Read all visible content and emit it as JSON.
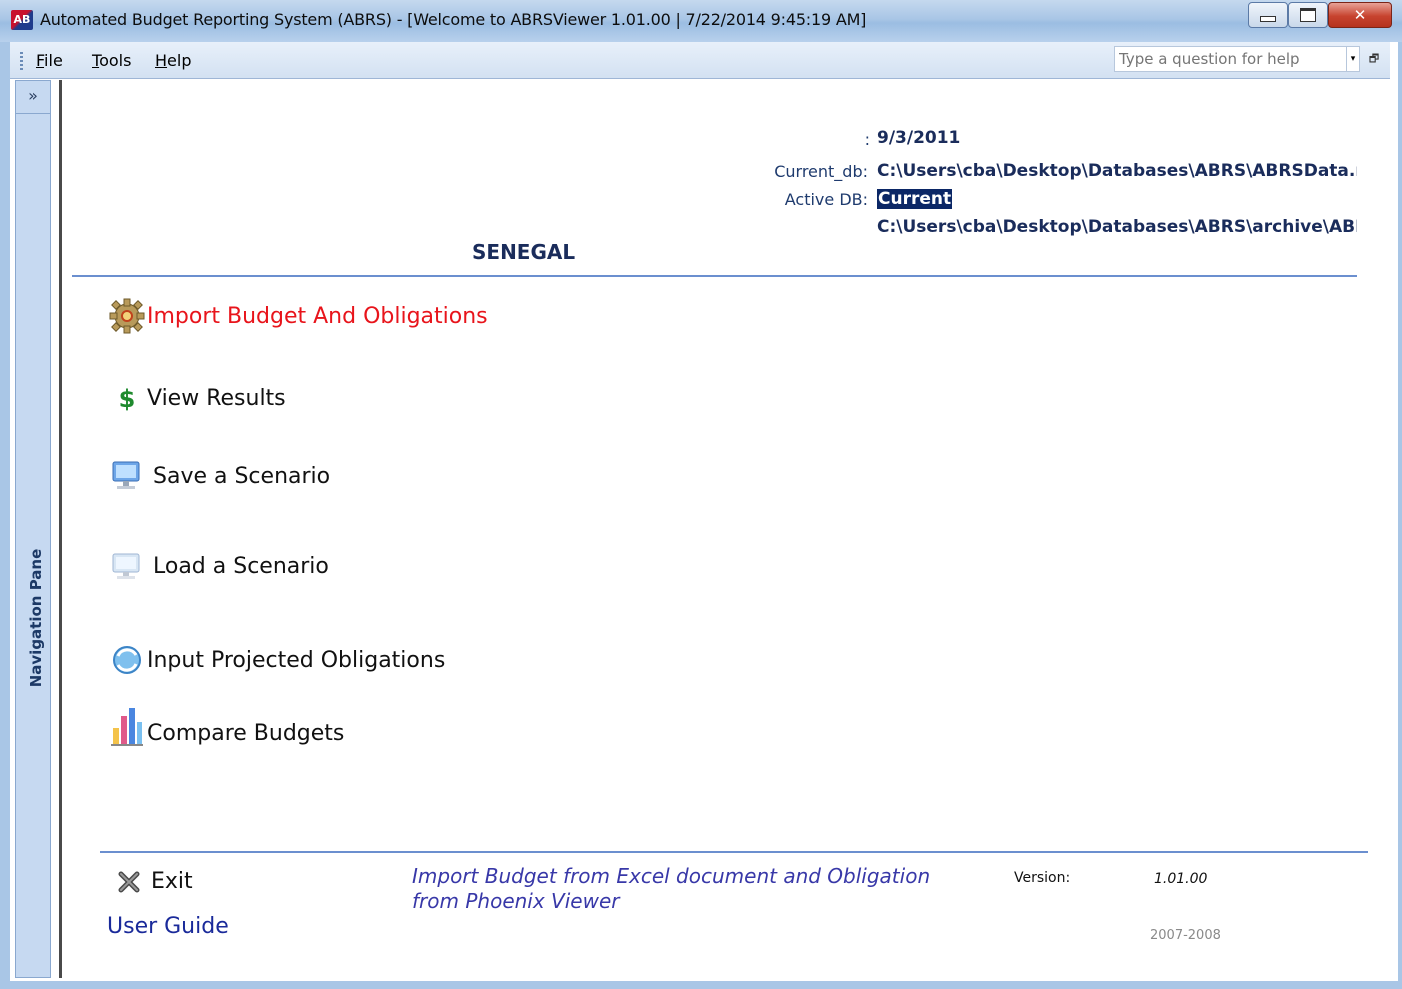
{
  "window": {
    "title": "Automated Budget Reporting System (ABRS) - [Welcome to ABRSViewer 1.01.00 | 7/22/2014 9:45:19 AM]",
    "app_icon_text": "AB",
    "close_glyph": "✕"
  },
  "menu": {
    "items": [
      {
        "label": "File",
        "underline": "F"
      },
      {
        "label": "Tools",
        "underline": "T"
      },
      {
        "label": "Help",
        "underline": "H"
      }
    ],
    "help_placeholder": "Type a question for help",
    "help_dropdown_glyph": "▾",
    "restore_glyph": "🗗"
  },
  "nav_pane": {
    "toggle_glyph": "»",
    "label": "Navigation Pane"
  },
  "info": {
    "colon": ":",
    "date": "9/3/2011",
    "current_db_label": "Current_db:",
    "current_db_value": "C:\\Users\\cba\\Desktop\\Databases\\ABRS\\ABRSData.mdb",
    "active_db_label": "Active DB:",
    "active_db_value": "Current",
    "archive_db_value": "C:\\Users\\cba\\Desktop\\Databases\\ABRS\\archive\\ABRSArchive.mdb",
    "country": "SENEGAL"
  },
  "actions": [
    {
      "label": "Import Budget And Obligations",
      "icon": "gear-icon"
    },
    {
      "label": "View Results",
      "icon": "dollar-icon"
    },
    {
      "label": "Save a Scenario",
      "icon": "computer-save-icon"
    },
    {
      "label": "Load a Scenario",
      "icon": "computer-load-icon"
    },
    {
      "label": "Input Projected Obligations",
      "icon": "refresh-globe-icon"
    },
    {
      "label": "Compare Budgets",
      "icon": "bar-chart-icon"
    }
  ],
  "footer": {
    "exit_label": "Exit",
    "user_guide_label": "User Guide",
    "description": "Import Budget from Excel document and Obligation from Phoenix Viewer",
    "version_label": "Version:",
    "version_value": "1.01.00",
    "copyright": "2007-2008"
  },
  "colors": {
    "title_bar": "#a9c6e6",
    "accent_rule": "#6b8fcf",
    "highlight_action": "#e8141b",
    "link": "#1a2a9a",
    "description": "#3838a8"
  }
}
